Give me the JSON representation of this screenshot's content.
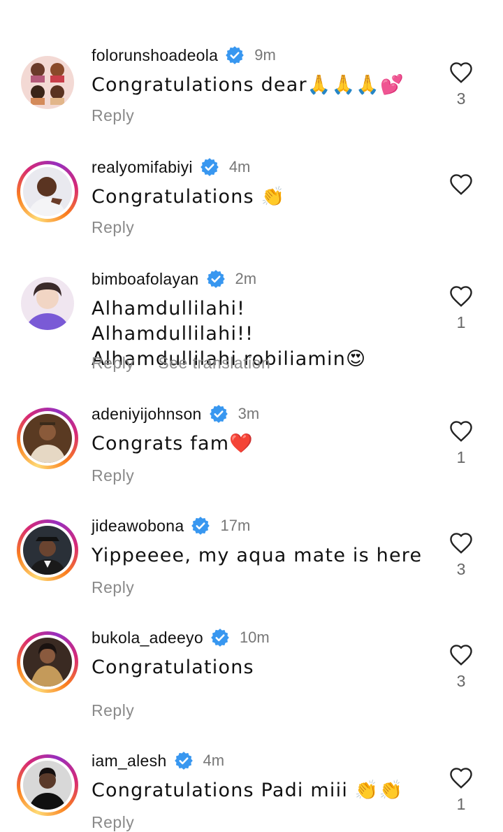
{
  "comments": [
    {
      "username": "folorunshoadeola",
      "time": "9m",
      "text": "Congratulations dear🙏🙏🙏💕",
      "reply": "Reply",
      "likes": "3",
      "story_ring": false
    },
    {
      "username": "realyomifabiyi",
      "time": "4m",
      "text": "Congratulations 👏",
      "reply": "Reply",
      "likes": "",
      "story_ring": true
    },
    {
      "username": "bimboafolayan",
      "time": "2m",
      "text": "Alhamdullilahi! Alhamdullilahi!! Alhamdullilahi robiliamin😍",
      "reply": "Reply",
      "translate": "See translation",
      "likes": "1",
      "story_ring": false
    },
    {
      "username": "adeniyijohnson",
      "time": "3m",
      "text": "Congrats fam❤️",
      "reply": "Reply",
      "likes": "1",
      "story_ring": true
    },
    {
      "username": "jideawobona",
      "time": "17m",
      "text": "Yippeeee, my aqua mate is here",
      "reply": "Reply",
      "likes": "3",
      "story_ring": true
    },
    {
      "username": "bukola_adeeyo",
      "time": "10m",
      "text": "Congratulations",
      "reply": "Reply",
      "likes": "3",
      "story_ring": true
    },
    {
      "username": "iam_alesh",
      "time": "4m",
      "text": "Congratulations Padi miii 👏👏",
      "reply": "Reply",
      "likes": "1",
      "story_ring": true
    }
  ],
  "colors": {
    "verified": "#3897f0",
    "heart_outline": "#222222",
    "meta_text": "#8a8a8a"
  }
}
